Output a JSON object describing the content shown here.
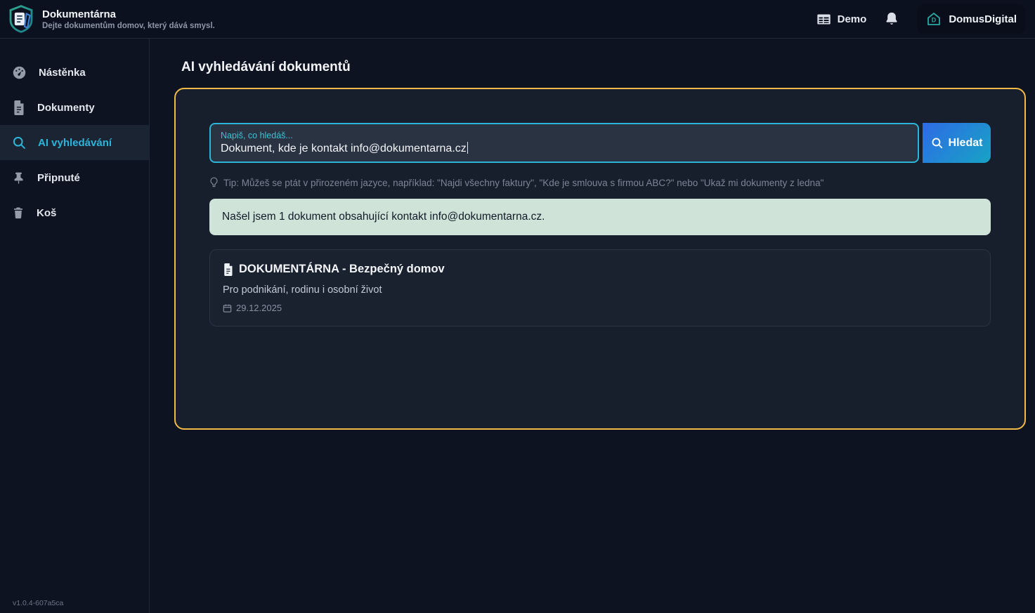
{
  "app": {
    "name": "Dokumentárna",
    "tagline": "Dejte dokumentům domov, který dává smysl.",
    "version": "v1.0.4-607a5ca"
  },
  "header": {
    "workspace_label": "Demo",
    "workspace_icon": "table-icon",
    "notifications_icon": "bell-icon",
    "account_label": "DomusDigital",
    "account_icon": "house-d-icon"
  },
  "sidebar": {
    "items": [
      {
        "label": "Nástěnka",
        "icon": "dashboard-gauge-icon",
        "active": false
      },
      {
        "label": "Dokumenty",
        "icon": "document-icon",
        "active": false
      },
      {
        "label": "AI vyhledávání",
        "icon": "search-icon",
        "active": true
      },
      {
        "label": "Připnuté",
        "icon": "pin-icon",
        "active": false
      },
      {
        "label": "Koš",
        "icon": "trash-icon",
        "active": false
      }
    ]
  },
  "main": {
    "title": "AI vyhledávání dokumentů",
    "search": {
      "label": "Napiš, co hledáš...",
      "value": "Dokument, kde je kontakt info@dokumentarna.cz",
      "button_label": "Hledat",
      "button_icon": "search-icon"
    },
    "tip": "Tip: Můžeš se ptát v přirozeném jazyce, například: \"Najdi všechny faktury\", \"Kde je smlouva s firmou ABC?\" nebo \"Ukaž mi dokumenty z ledna\"",
    "tip_icon": "lightbulb-icon",
    "result_message": "Našel jsem 1 dokument obsahující kontakt info@dokumentarna.cz.",
    "results": [
      {
        "title": "DOKUMENTÁRNA - Bezpečný domov",
        "subtitle": "Pro podnikání, rodinu i osobní život",
        "date": "29.12.2025"
      }
    ]
  },
  "colors": {
    "page_bg": "#0d1320",
    "panel_bg": "#171e2c",
    "panel_border": "#f2ba47",
    "input_border": "#2cb5d6",
    "input_bg": "#2a3342",
    "accent_cyan": "#2db4da",
    "button_gradient_start": "#2e6be6",
    "button_gradient_end": "#17a3c4",
    "success_bg": "#cfe3d9",
    "success_text": "#121a27"
  }
}
